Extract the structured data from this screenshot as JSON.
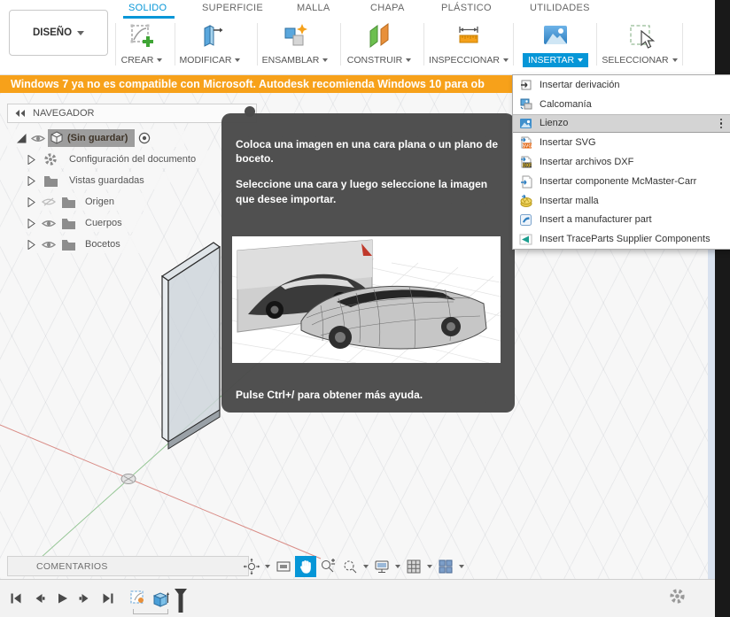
{
  "colors": {
    "accent_blue": "#0696D7",
    "banner_orange": "#F7A11A",
    "tooltip_bg": "#4A4A4A",
    "menu_highlight": "#D4D4D4"
  },
  "design_menu": {
    "label": "DISEÑO"
  },
  "tabs": {
    "active": "SOLIDO",
    "items": [
      {
        "label": "SOLIDO"
      },
      {
        "label": "SUPERFICIE"
      },
      {
        "label": "MALLA"
      },
      {
        "label": "CHAPA"
      },
      {
        "label": "PLÁSTICO"
      },
      {
        "label": "UTILIDADES"
      }
    ]
  },
  "toolbar": {
    "active_group": "INSERTAR",
    "groups": [
      {
        "label": "CREAR",
        "icon": "create-sketch-icon"
      },
      {
        "label": "MODIFICAR",
        "icon": "press-pull-icon"
      },
      {
        "label": "ENSAMBLAR",
        "icon": "new-component-icon"
      },
      {
        "label": "CONSTRUIR",
        "icon": "construction-plane-icon"
      },
      {
        "label": "INSPECCIONAR",
        "icon": "measure-icon"
      },
      {
        "label": "INSERTAR",
        "icon": "insert-image-icon"
      },
      {
        "label": "SELECCIONAR",
        "icon": "select-box-icon"
      }
    ]
  },
  "banner": {
    "text": "Windows 7 ya no es compatible con Microsoft. Autodesk recomienda Windows 10 para ob"
  },
  "navigator": {
    "title": "NAVEGADOR",
    "root_label": "(Sin guardar)",
    "items": [
      {
        "label": "Configuración del documento",
        "icon": "gear",
        "visibility": "none"
      },
      {
        "label": "Vistas guardadas",
        "icon": "folder",
        "visibility": "none"
      },
      {
        "label": "Origen",
        "icon": "folder",
        "visibility": "hidden"
      },
      {
        "label": "Cuerpos",
        "icon": "folder",
        "visibility": "visible"
      },
      {
        "label": "Bocetos",
        "icon": "folder",
        "visibility": "visible"
      }
    ]
  },
  "insert_menu": {
    "highlighted": "Lienzo",
    "items": [
      {
        "label": "Insertar derivación",
        "icon": "insert-derive-icon"
      },
      {
        "label": "Calcomanía",
        "icon": "decal-icon"
      },
      {
        "label": "Lienzo",
        "icon": "canvas-icon"
      },
      {
        "label": "Insertar SVG",
        "icon": "insert-svg-icon"
      },
      {
        "label": "Insertar archivos DXF",
        "icon": "insert-dxf-icon"
      },
      {
        "label": "Insertar componente McMaster-Carr",
        "icon": "mcmaster-icon"
      },
      {
        "label": "Insertar malla",
        "icon": "insert-mesh-icon"
      },
      {
        "label": "Insert a manufacturer part",
        "icon": "manufacturer-part-icon"
      },
      {
        "label": "Insert TraceParts Supplier Components",
        "icon": "traceparts-icon"
      }
    ]
  },
  "help_tooltip": {
    "paragraph1": "Coloca una imagen en una cara plana o un plano de boceto.",
    "paragraph2": "Seleccione una cara y luego seleccione la imagen que desee importar.",
    "footer": "Pulse Ctrl+/ para obtener más ayuda."
  },
  "comments_bar": {
    "label": "COMENTARIOS"
  },
  "view_toolbar": {
    "buttons": [
      "orbit-icon",
      "look-at-icon",
      "pan-icon",
      "zoom-icon",
      "fit-icon",
      "display-settings-icon",
      "grid-display-icon",
      "viewports-icon"
    ],
    "active_button": "pan-icon"
  },
  "timeline": {
    "playback": [
      "go-to-start-icon",
      "step-back-icon",
      "play-icon",
      "step-forward-icon",
      "go-to-end-icon"
    ],
    "feature_icons": [
      "sketch-feature-icon",
      "body-feature-icon"
    ],
    "settings_icon": "gear-icon"
  }
}
